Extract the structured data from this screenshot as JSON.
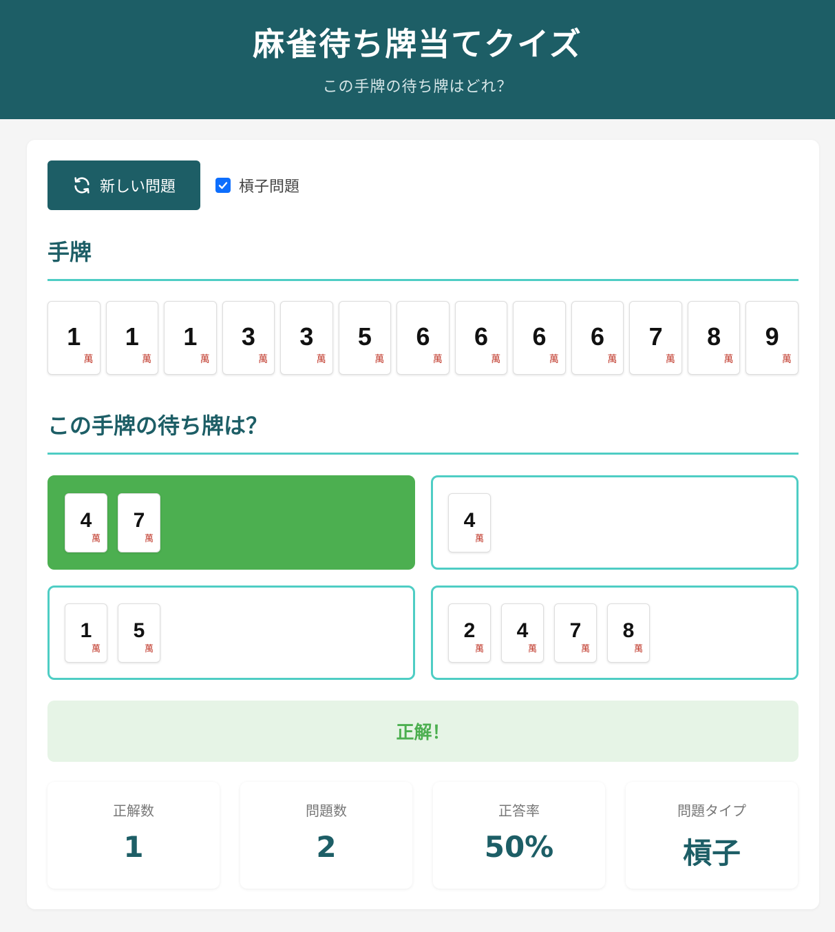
{
  "header": {
    "title": "麻雀待ち牌当てクイズ",
    "subtitle": "この手牌の待ち牌はどれ？"
  },
  "controls": {
    "new_button_label": "新しい問題",
    "new_button_icon": "refresh-icon",
    "kan_checkbox_label": "槓子問題",
    "kan_checkbox_checked": true
  },
  "hand_section": {
    "title": "手牌",
    "tiles": [
      {
        "num": "1",
        "suit": "萬"
      },
      {
        "num": "1",
        "suit": "萬"
      },
      {
        "num": "1",
        "suit": "萬"
      },
      {
        "num": "3",
        "suit": "萬"
      },
      {
        "num": "3",
        "suit": "萬"
      },
      {
        "num": "5",
        "suit": "萬"
      },
      {
        "num": "6",
        "suit": "萬"
      },
      {
        "num": "6",
        "suit": "萬"
      },
      {
        "num": "6",
        "suit": "萬"
      },
      {
        "num": "6",
        "suit": "萬"
      },
      {
        "num": "7",
        "suit": "萬"
      },
      {
        "num": "8",
        "suit": "萬"
      },
      {
        "num": "9",
        "suit": "萬"
      }
    ]
  },
  "question": {
    "title": "この手牌の待ち牌は？",
    "options": [
      {
        "state": "correct",
        "tiles": [
          {
            "num": "4",
            "suit": "萬"
          },
          {
            "num": "7",
            "suit": "萬"
          }
        ]
      },
      {
        "state": "normal",
        "tiles": [
          {
            "num": "4",
            "suit": "萬"
          }
        ]
      },
      {
        "state": "normal",
        "tiles": [
          {
            "num": "1",
            "suit": "萬"
          },
          {
            "num": "5",
            "suit": "萬"
          }
        ]
      },
      {
        "state": "normal",
        "tiles": [
          {
            "num": "2",
            "suit": "萬"
          },
          {
            "num": "4",
            "suit": "萬"
          },
          {
            "num": "7",
            "suit": "萬"
          },
          {
            "num": "8",
            "suit": "萬"
          }
        ]
      }
    ]
  },
  "result": {
    "message": "正解！"
  },
  "stats": [
    {
      "label": "正解数",
      "value": "1"
    },
    {
      "label": "問題数",
      "value": "2"
    },
    {
      "label": "正答率",
      "value": "50%"
    },
    {
      "label": "問題タイプ",
      "value": "槓子"
    }
  ],
  "colors": {
    "primary": "#1d5e66",
    "accent": "#4ecdc4",
    "correct": "#4caf50",
    "suit_red": "#c0392b"
  }
}
